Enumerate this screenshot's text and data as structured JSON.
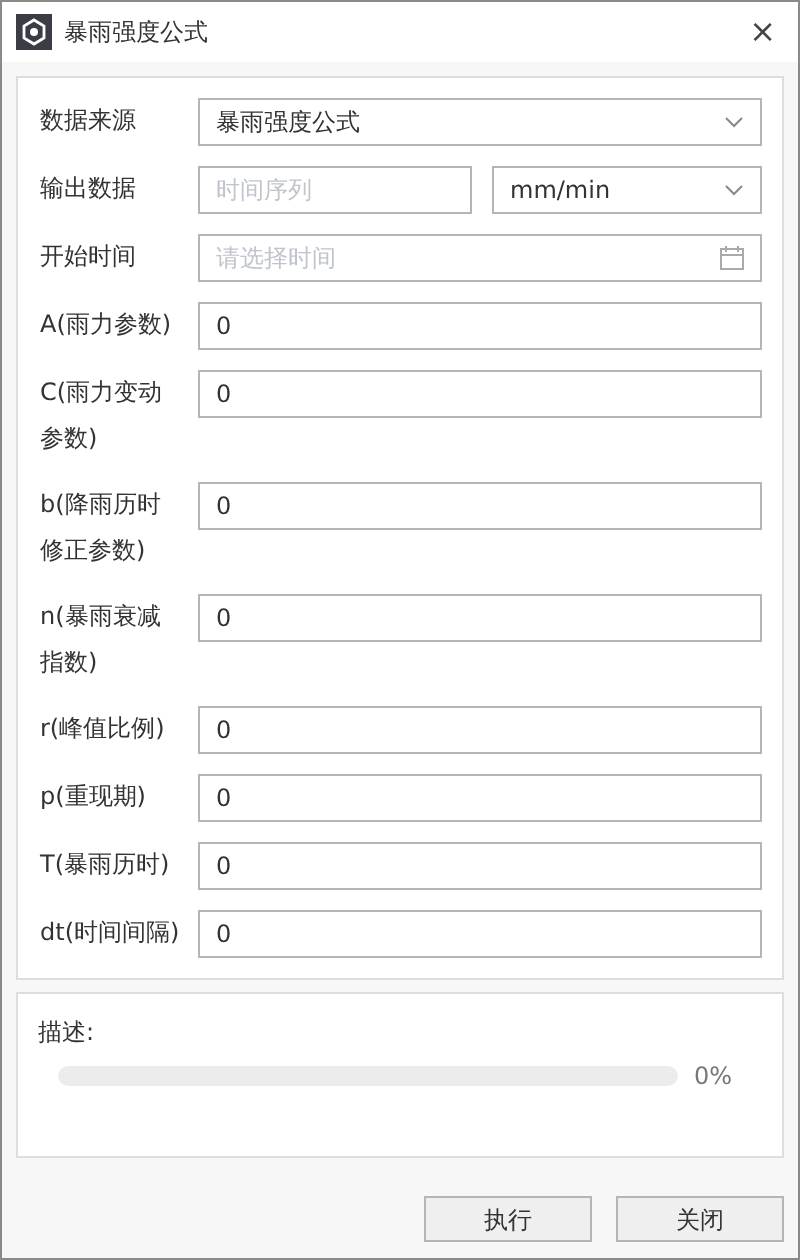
{
  "window": {
    "title": "暴雨强度公式",
    "close": "×"
  },
  "form": {
    "rows": [
      {
        "kind": "select",
        "label": "数据来源",
        "value": "暴雨强度公式"
      },
      {
        "kind": "output",
        "label": "输出数据",
        "placeholder": "时间序列",
        "unit": "mm/min"
      },
      {
        "kind": "date",
        "label": "开始时间",
        "placeholder": "请选择时间"
      },
      {
        "kind": "text",
        "label": "A(雨力参数)",
        "value": "0"
      },
      {
        "kind": "text",
        "label": "C(雨力变动参数)",
        "value": "0"
      },
      {
        "kind": "text",
        "label": "b(降雨历时修正参数)",
        "value": "0"
      },
      {
        "kind": "text",
        "label": "n(暴雨衰减指数)",
        "value": "0"
      },
      {
        "kind": "text",
        "label": "r(峰值比例)",
        "value": "0"
      },
      {
        "kind": "text",
        "label": "p(重现期)",
        "value": "0"
      },
      {
        "kind": "text",
        "label": "T(暴雨历时)",
        "value": "0"
      },
      {
        "kind": "text",
        "label": "dt(时间间隔)",
        "value": "0"
      }
    ]
  },
  "status": {
    "label": "描述:",
    "level": 0,
    "reading": "0%"
  },
  "buttons": [
    "执行",
    "关闭"
  ]
}
